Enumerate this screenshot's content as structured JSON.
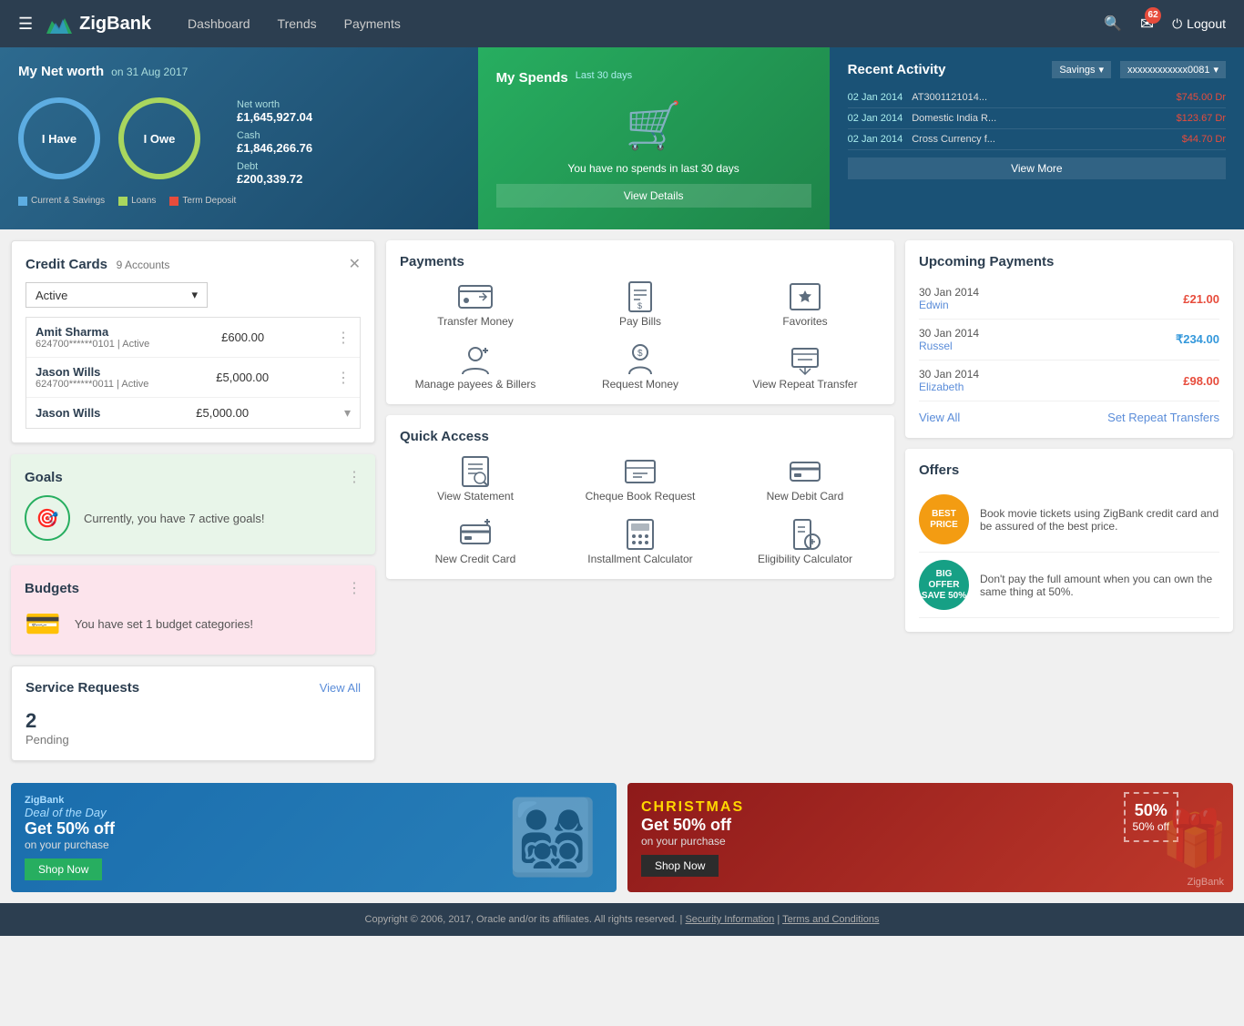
{
  "header": {
    "logo_text": "ZigBank",
    "nav": [
      {
        "label": "Dashboard",
        "href": "#"
      },
      {
        "label": "Trends",
        "href": "#"
      },
      {
        "label": "Payments",
        "href": "#"
      }
    ],
    "badge_count": "62",
    "logout_label": "Logout"
  },
  "hero": {
    "net_worth": {
      "title": "My Net worth",
      "date": "on 31 Aug 2017",
      "i_have": "I Have",
      "i_owe": "I Owe",
      "net_worth_label": "Net worth",
      "net_worth_value": "£1,645,927.04",
      "cash_label": "Cash",
      "cash_value": "£1,846,266.76",
      "debt_label": "Debt",
      "debt_value": "£200,339.72",
      "legend": [
        {
          "color": "#5dade2",
          "label": "Current & Savings"
        },
        {
          "color": "#a9d65e",
          "label": "Loans"
        },
        {
          "color": "#e74c3c",
          "label": "Term Deposit"
        }
      ]
    },
    "spends": {
      "title": "My Spends",
      "period": "Last 30 days",
      "message": "You have no spends in last 30 days",
      "view_details": "View Details"
    },
    "activity": {
      "title": "Recent Activity",
      "account_type": "Savings",
      "account_number": "xxxxxxxxxxxx0081",
      "rows": [
        {
          "date": "02 Jan 2014",
          "desc": "AT3001121014...",
          "amount": "$745.00 Dr"
        },
        {
          "date": "02 Jan 2014",
          "desc": "Domestic India R...",
          "amount": "$123.67 Dr"
        },
        {
          "date": "02 Jan 2014",
          "desc": "Cross Currency f...",
          "amount": "$44.70 Dr"
        }
      ],
      "view_more": "View More"
    }
  },
  "credit_cards": {
    "title": "Credit Cards",
    "count": "9 Accounts",
    "filter": "Active",
    "accounts": [
      {
        "name": "Amit Sharma",
        "number": "624700******0101",
        "status": "Active",
        "limit": "£600.00"
      },
      {
        "name": "Jason Wills",
        "number": "624700******0011",
        "status": "Active",
        "limit": "£5,000.00"
      },
      {
        "name": "Jason Wills",
        "number": "",
        "status": "",
        "limit": "£5,000.00"
      }
    ]
  },
  "payments": {
    "title": "Payments",
    "items": [
      {
        "label": "Transfer Money",
        "icon": "transfer"
      },
      {
        "label": "Pay Bills",
        "icon": "bills"
      },
      {
        "label": "Favorites",
        "icon": "favorites"
      },
      {
        "label": "Manage payees & Billers",
        "icon": "payees"
      },
      {
        "label": "Request Money",
        "icon": "request"
      },
      {
        "label": "View Repeat Transfer",
        "icon": "repeat"
      }
    ]
  },
  "upcoming_payments": {
    "title": "Upcoming Payments",
    "items": [
      {
        "date": "30 Jan 2014",
        "name": "Edwin",
        "amount": "£21.00",
        "color": "red"
      },
      {
        "date": "30 Jan 2014",
        "name": "Russel",
        "amount": "₹234.00",
        "color": "blue"
      },
      {
        "date": "30 Jan 2014",
        "name": "Elizabeth",
        "amount": "£98.00",
        "color": "red"
      }
    ],
    "view_all": "View All",
    "set_repeat": "Set Repeat Transfers"
  },
  "goals": {
    "title": "Goals",
    "message": "Currently, you have 7 active goals!"
  },
  "budgets": {
    "title": "Budgets",
    "message": "You have set 1 budget categories!"
  },
  "quick_access": {
    "title": "Quick Access",
    "items": [
      {
        "label": "View Statement",
        "icon": "statement"
      },
      {
        "label": "Cheque Book Request",
        "icon": "cheque"
      },
      {
        "label": "New Debit Card",
        "icon": "debit"
      },
      {
        "label": "New Credit Card",
        "icon": "credit"
      },
      {
        "label": "Installment Calculator",
        "icon": "calculator"
      },
      {
        "label": "Eligibility Calculator",
        "icon": "eligibility"
      }
    ]
  },
  "offers": {
    "title": "Offers",
    "items": [
      {
        "badge_line1": "BEST",
        "badge_line2": "PRICE",
        "badge_color": "#f39c12",
        "desc": "Book movie tickets using ZigBank credit card and be assured of the best price."
      },
      {
        "badge_line1": "BIG",
        "badge_line2": "OFFER",
        "badge_line3": "SAVE 50%",
        "badge_color": "#16a085",
        "desc": "Don't pay the full amount when you can own the same thing at 50%."
      }
    ]
  },
  "service_requests": {
    "title": "Service Requests",
    "view_all": "View All",
    "pending_count": "2",
    "pending_label": "Pending"
  },
  "banners": [
    {
      "brand": "ZigBank",
      "deal": "Deal of the Day",
      "offer": "Get 50% off",
      "sub": "on your purchase",
      "btn": "Shop Now",
      "type": "zigbank"
    },
    {
      "brand": "CHRISTMAS",
      "offer": "Get 50% off",
      "sub": "on your purchase",
      "btn": "Shop Now",
      "badge": "50% off",
      "type": "christmas"
    }
  ],
  "footer": {
    "text": "Copyright © 2006, 2017, Oracle and/or its affiliates. All rights reserved.",
    "links": [
      "Security Information",
      "Terms and Conditions"
    ]
  }
}
